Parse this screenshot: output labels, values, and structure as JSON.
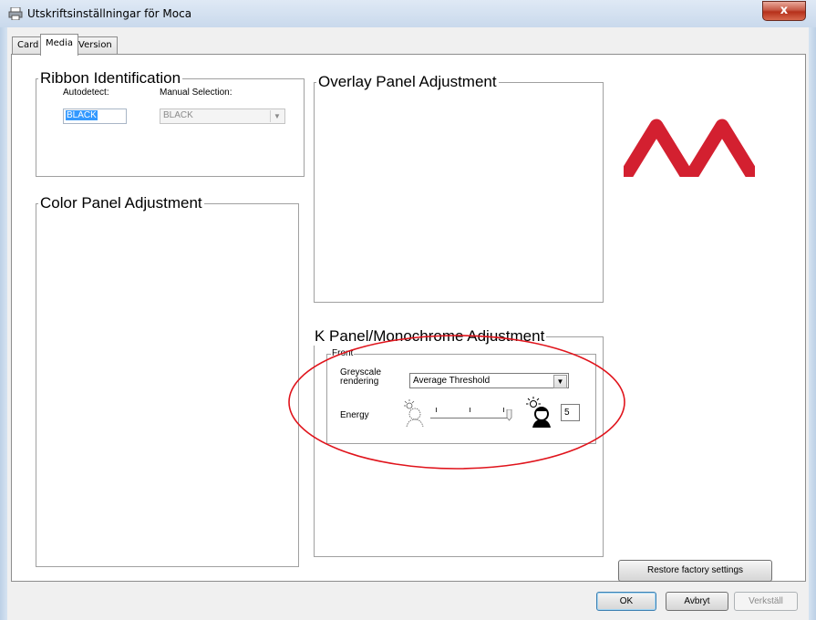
{
  "window": {
    "title": "Utskriftsinställningar för Moca",
    "close_label": "x"
  },
  "tabs": [
    {
      "label": "Card",
      "active": false
    },
    {
      "label": "Media",
      "active": true
    },
    {
      "label": "Version",
      "active": false
    }
  ],
  "ribbon": {
    "title": "Ribbon Identification",
    "autodetect_label": "Autodetect:",
    "autodetect_value": "BLACK",
    "manual_label": "Manual Selection:",
    "manual_value": "BLACK"
  },
  "color_panel": {
    "title": "Color Panel Adjustment"
  },
  "overlay_panel": {
    "title": "Overlay Panel Adjustment"
  },
  "k_panel": {
    "title": "K Panel/Monochrome Adjustment",
    "front_label": "Front",
    "greyscale_label_line1": "Greyscale",
    "greyscale_label_line2": "rendering",
    "greyscale_value": "Average Threshold",
    "energy_label": "Energy",
    "energy_value": "5"
  },
  "buttons": {
    "restore": "Restore factory settings",
    "ok": "OK",
    "cancel": "Avbryt",
    "apply": "Verkställ"
  },
  "colors": {
    "logo_red": "#d32030",
    "highlight_ellipse": "#e0141c"
  }
}
